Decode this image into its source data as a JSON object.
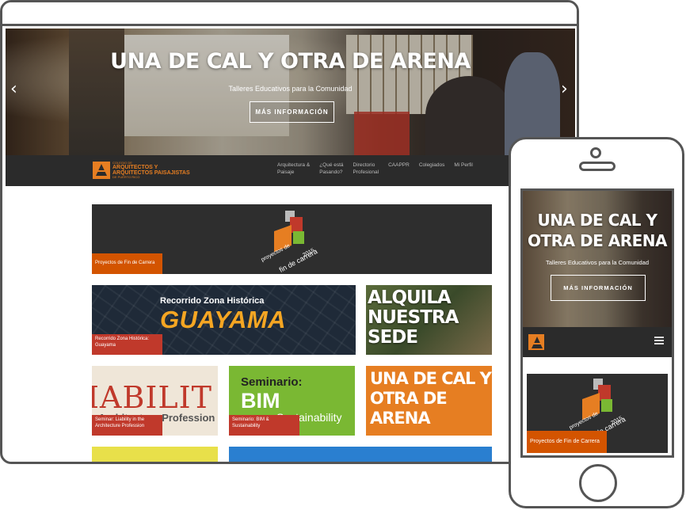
{
  "tablet": {
    "hero": {
      "title": "UNA DE CAL Y OTRA DE ARENA",
      "subtitle": "Talleres Educativos para la Comunidad",
      "button": "MÁS INFORMACIÓN",
      "prev_icon": "‹",
      "next_icon": "›"
    },
    "logo": {
      "line1": "COLEGIO DE",
      "line2": "ARQUITECTOS Y",
      "line3": "ARQUITECTOS PAISAJISTAS",
      "line4": "DE PUERTO RICO"
    },
    "nav": [
      "Arquitectura &\nPaisaje",
      "¿Qué está\nPasando?",
      "Directorio\nProfesional",
      "CAAPPR",
      "Colegiados",
      "Mi Perfil"
    ],
    "tiles": {
      "pfc_caption": "Proyectos de Fin de Carrera",
      "pfc_label_1": "proyectos de",
      "pfc_label_2": "fin de carrera",
      "pfc_label_3": "2015",
      "guayama_line1": "Recorrido Zona Histórica",
      "guayama_line2": "GUAYAMA",
      "guayama_caption": "Recorrido Zona Histórica:\nGuayama",
      "sede_text": "ALQUILA NUESTRA SEDE",
      "liab_big": "IABILIT",
      "liab_small": "Architecture Profession",
      "liab_caption": "Seminar: Liability in the\nArchitecture Profession",
      "bim_a": "Seminario:",
      "bim_b": "BIM",
      "bim_c": "Sustainability",
      "bim_caption": "Seminario: BIM &\nSustainability",
      "cal_text": "UNA DE CAL Y OTRA DE ARENA"
    }
  },
  "phone": {
    "hero": {
      "title": "UNA DE CAL Y OTRA DE ARENA",
      "subtitle": "Talleres Educativos para la Comunidad",
      "button": "MÁS INFORMACIÓN"
    },
    "tile_caption": "Proyectos de Fin de Carrera",
    "tile_label_1": "proyectos de",
    "tile_label_2": "fin de carrera",
    "tile_label_3": "2015"
  },
  "colors": {
    "accent_orange": "#e67e22",
    "caption_red": "#c0392b",
    "nav_dark": "#2b2b2b",
    "bim_green": "#7ab833"
  },
  "icons": [
    "chevron-left-icon",
    "chevron-right-icon",
    "logo-icon",
    "hamburger-icon",
    "camera-icon",
    "speaker-icon",
    "home-button-icon"
  ]
}
